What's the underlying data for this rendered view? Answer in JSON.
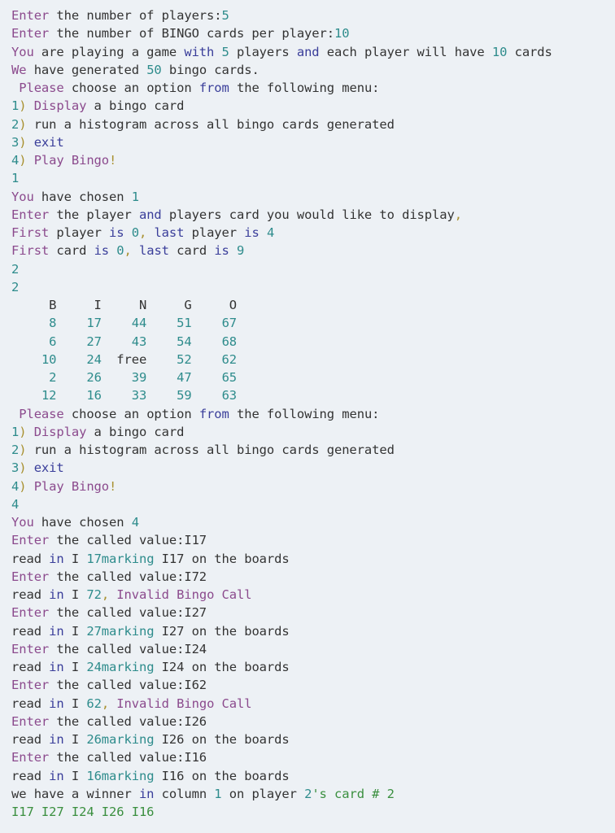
{
  "console": {
    "lines": [
      {
        "kind": "prompt",
        "tokens": [
          [
            "purple",
            "Enter"
          ],
          [
            "plain",
            " the number of players:"
          ],
          [
            "teal",
            "5"
          ]
        ]
      },
      {
        "kind": "prompt",
        "tokens": [
          [
            "purple",
            "Enter"
          ],
          [
            "plain",
            " the number of BINGO cards per player:"
          ],
          [
            "teal",
            "10"
          ]
        ]
      },
      {
        "kind": "output",
        "tokens": [
          [
            "purple",
            "You"
          ],
          [
            "plain",
            " are playing a game "
          ],
          [
            "navy",
            "with"
          ],
          [
            "plain",
            " "
          ],
          [
            "teal",
            "5"
          ],
          [
            "plain",
            " players "
          ],
          [
            "navy",
            "and"
          ],
          [
            "plain",
            " each player will have "
          ],
          [
            "teal",
            "10"
          ],
          [
            "plain",
            " cards"
          ]
        ]
      },
      {
        "kind": "output",
        "tokens": [
          [
            "purple",
            "We"
          ],
          [
            "plain",
            " have generated "
          ],
          [
            "teal",
            "50"
          ],
          [
            "plain",
            " bingo cards."
          ]
        ]
      },
      {
        "kind": "menu-title",
        "tokens": [
          [
            "plain",
            " "
          ],
          [
            "purple",
            "Please"
          ],
          [
            "plain",
            " choose an option "
          ],
          [
            "navy",
            "from"
          ],
          [
            "plain",
            " the following menu:"
          ]
        ]
      },
      {
        "kind": "menu-item",
        "tokens": [
          [
            "teal",
            "1"
          ],
          [
            "punct",
            ")"
          ],
          [
            "plain",
            " "
          ],
          [
            "purple",
            "Display"
          ],
          [
            "plain",
            " a bingo card"
          ]
        ]
      },
      {
        "kind": "menu-item",
        "tokens": [
          [
            "teal",
            "2"
          ],
          [
            "punct",
            ")"
          ],
          [
            "plain",
            " run a histogram across all bingo cards generated"
          ]
        ]
      },
      {
        "kind": "menu-item",
        "tokens": [
          [
            "teal",
            "3"
          ],
          [
            "punct",
            ")"
          ],
          [
            "plain",
            " "
          ],
          [
            "navy",
            "exit"
          ]
        ]
      },
      {
        "kind": "menu-item",
        "tokens": [
          [
            "teal",
            "4"
          ],
          [
            "punct",
            ")"
          ],
          [
            "plain",
            " "
          ],
          [
            "purple",
            "Play Bingo"
          ],
          [
            "punct",
            "!"
          ]
        ]
      },
      {
        "kind": "input",
        "tokens": [
          [
            "teal",
            "1"
          ]
        ]
      },
      {
        "kind": "output",
        "tokens": [
          [
            "purple",
            "You"
          ],
          [
            "plain",
            " have chosen "
          ],
          [
            "teal",
            "1"
          ]
        ]
      },
      {
        "kind": "prompt",
        "tokens": [
          [
            "purple",
            "Enter"
          ],
          [
            "plain",
            " the player "
          ],
          [
            "navy",
            "and"
          ],
          [
            "plain",
            " players card you would like to display"
          ],
          [
            "punct",
            ","
          ]
        ]
      },
      {
        "kind": "output",
        "tokens": [
          [
            "purple",
            "First"
          ],
          [
            "plain",
            " player "
          ],
          [
            "navy",
            "is"
          ],
          [
            "plain",
            " "
          ],
          [
            "teal",
            "0"
          ],
          [
            "punct",
            ","
          ],
          [
            "plain",
            " "
          ],
          [
            "navy",
            "last"
          ],
          [
            "plain",
            " player "
          ],
          [
            "navy",
            "is"
          ],
          [
            "plain",
            " "
          ],
          [
            "teal",
            "4"
          ]
        ]
      },
      {
        "kind": "output",
        "tokens": [
          [
            "purple",
            "First"
          ],
          [
            "plain",
            " card "
          ],
          [
            "navy",
            "is"
          ],
          [
            "plain",
            " "
          ],
          [
            "teal",
            "0"
          ],
          [
            "punct",
            ","
          ],
          [
            "plain",
            " "
          ],
          [
            "navy",
            "last"
          ],
          [
            "plain",
            " card "
          ],
          [
            "navy",
            "is"
          ],
          [
            "plain",
            " "
          ],
          [
            "teal",
            "9"
          ]
        ]
      },
      {
        "kind": "input",
        "tokens": [
          [
            "teal",
            "2"
          ]
        ]
      },
      {
        "kind": "input",
        "tokens": [
          [
            "teal",
            "2"
          ]
        ]
      },
      {
        "kind": "card-header",
        "tokens": [
          [
            "plain",
            "     B     I     N     G     O"
          ]
        ]
      },
      {
        "kind": "card-row",
        "tokens": [
          [
            "plain",
            "     "
          ],
          [
            "teal",
            "8"
          ],
          [
            "plain",
            "    "
          ],
          [
            "teal",
            "17"
          ],
          [
            "plain",
            "    "
          ],
          [
            "teal",
            "44"
          ],
          [
            "plain",
            "    "
          ],
          [
            "teal",
            "51"
          ],
          [
            "plain",
            "    "
          ],
          [
            "teal",
            "67"
          ]
        ]
      },
      {
        "kind": "card-row",
        "tokens": [
          [
            "plain",
            "     "
          ],
          [
            "teal",
            "6"
          ],
          [
            "plain",
            "    "
          ],
          [
            "teal",
            "27"
          ],
          [
            "plain",
            "    "
          ],
          [
            "teal",
            "43"
          ],
          [
            "plain",
            "    "
          ],
          [
            "teal",
            "54"
          ],
          [
            "plain",
            "    "
          ],
          [
            "teal",
            "68"
          ]
        ]
      },
      {
        "kind": "card-row",
        "tokens": [
          [
            "plain",
            "    "
          ],
          [
            "teal",
            "10"
          ],
          [
            "plain",
            "    "
          ],
          [
            "teal",
            "24"
          ],
          [
            "plain",
            "  free    "
          ],
          [
            "teal",
            "52"
          ],
          [
            "plain",
            "    "
          ],
          [
            "teal",
            "62"
          ]
        ]
      },
      {
        "kind": "card-row",
        "tokens": [
          [
            "plain",
            "     "
          ],
          [
            "teal",
            "2"
          ],
          [
            "plain",
            "    "
          ],
          [
            "teal",
            "26"
          ],
          [
            "plain",
            "    "
          ],
          [
            "teal",
            "39"
          ],
          [
            "plain",
            "    "
          ],
          [
            "teal",
            "47"
          ],
          [
            "plain",
            "    "
          ],
          [
            "teal",
            "65"
          ]
        ]
      },
      {
        "kind": "card-row",
        "tokens": [
          [
            "plain",
            "    "
          ],
          [
            "teal",
            "12"
          ],
          [
            "plain",
            "    "
          ],
          [
            "teal",
            "16"
          ],
          [
            "plain",
            "    "
          ],
          [
            "teal",
            "33"
          ],
          [
            "plain",
            "    "
          ],
          [
            "teal",
            "59"
          ],
          [
            "plain",
            "    "
          ],
          [
            "teal",
            "63"
          ]
        ]
      },
      {
        "kind": "menu-title",
        "tokens": [
          [
            "plain",
            " "
          ],
          [
            "purple",
            "Please"
          ],
          [
            "plain",
            " choose an option "
          ],
          [
            "navy",
            "from"
          ],
          [
            "plain",
            " the following menu:"
          ]
        ]
      },
      {
        "kind": "menu-item",
        "tokens": [
          [
            "teal",
            "1"
          ],
          [
            "punct",
            ")"
          ],
          [
            "plain",
            " "
          ],
          [
            "purple",
            "Display"
          ],
          [
            "plain",
            " a bingo card"
          ]
        ]
      },
      {
        "kind": "menu-item",
        "tokens": [
          [
            "teal",
            "2"
          ],
          [
            "punct",
            ")"
          ],
          [
            "plain",
            " run a histogram across all bingo cards generated"
          ]
        ]
      },
      {
        "kind": "menu-item",
        "tokens": [
          [
            "teal",
            "3"
          ],
          [
            "punct",
            ")"
          ],
          [
            "plain",
            " "
          ],
          [
            "navy",
            "exit"
          ]
        ]
      },
      {
        "kind": "menu-item",
        "tokens": [
          [
            "teal",
            "4"
          ],
          [
            "punct",
            ")"
          ],
          [
            "plain",
            " "
          ],
          [
            "purple",
            "Play Bingo"
          ],
          [
            "punct",
            "!"
          ]
        ]
      },
      {
        "kind": "input",
        "tokens": [
          [
            "teal",
            "4"
          ]
        ]
      },
      {
        "kind": "output",
        "tokens": [
          [
            "purple",
            "You"
          ],
          [
            "plain",
            " have chosen "
          ],
          [
            "teal",
            "4"
          ]
        ]
      },
      {
        "kind": "prompt",
        "tokens": [
          [
            "purple",
            "Enter"
          ],
          [
            "plain",
            " the called value:I17"
          ]
        ]
      },
      {
        "kind": "output",
        "tokens": [
          [
            "plain",
            "read "
          ],
          [
            "navy",
            "in"
          ],
          [
            "plain",
            " I "
          ],
          [
            "teal",
            "17marking"
          ],
          [
            "plain",
            " I17 on the boards"
          ]
        ]
      },
      {
        "kind": "prompt",
        "tokens": [
          [
            "purple",
            "Enter"
          ],
          [
            "plain",
            " the called value:I72"
          ]
        ]
      },
      {
        "kind": "output",
        "tokens": [
          [
            "plain",
            "read "
          ],
          [
            "navy",
            "in"
          ],
          [
            "plain",
            " I "
          ],
          [
            "teal",
            "72"
          ],
          [
            "punct",
            ","
          ],
          [
            "plain",
            " "
          ],
          [
            "purple",
            "Invalid Bingo Call"
          ]
        ]
      },
      {
        "kind": "prompt",
        "tokens": [
          [
            "purple",
            "Enter"
          ],
          [
            "plain",
            " the called value:I27"
          ]
        ]
      },
      {
        "kind": "output",
        "tokens": [
          [
            "plain",
            "read "
          ],
          [
            "navy",
            "in"
          ],
          [
            "plain",
            " I "
          ],
          [
            "teal",
            "27marking"
          ],
          [
            "plain",
            " I27 on the boards"
          ]
        ]
      },
      {
        "kind": "prompt",
        "tokens": [
          [
            "purple",
            "Enter"
          ],
          [
            "plain",
            " the called value:I24"
          ]
        ]
      },
      {
        "kind": "output",
        "tokens": [
          [
            "plain",
            "read "
          ],
          [
            "navy",
            "in"
          ],
          [
            "plain",
            " I "
          ],
          [
            "teal",
            "24marking"
          ],
          [
            "plain",
            " I24 on the boards"
          ]
        ]
      },
      {
        "kind": "prompt",
        "tokens": [
          [
            "purple",
            "Enter"
          ],
          [
            "plain",
            " the called value:I62"
          ]
        ]
      },
      {
        "kind": "output",
        "tokens": [
          [
            "plain",
            "read "
          ],
          [
            "navy",
            "in"
          ],
          [
            "plain",
            " I "
          ],
          [
            "teal",
            "62"
          ],
          [
            "punct",
            ","
          ],
          [
            "plain",
            " "
          ],
          [
            "purple",
            "Invalid Bingo Call"
          ]
        ]
      },
      {
        "kind": "prompt",
        "tokens": [
          [
            "purple",
            "Enter"
          ],
          [
            "plain",
            " the called value:I26"
          ]
        ]
      },
      {
        "kind": "output",
        "tokens": [
          [
            "plain",
            "read "
          ],
          [
            "navy",
            "in"
          ],
          [
            "plain",
            " I "
          ],
          [
            "teal",
            "26marking"
          ],
          [
            "plain",
            " I26 on the boards"
          ]
        ]
      },
      {
        "kind": "prompt",
        "tokens": [
          [
            "purple",
            "Enter"
          ],
          [
            "plain",
            " the called value:I16"
          ]
        ]
      },
      {
        "kind": "output",
        "tokens": [
          [
            "plain",
            "read "
          ],
          [
            "navy",
            "in"
          ],
          [
            "plain",
            " I "
          ],
          [
            "teal",
            "16marking"
          ],
          [
            "plain",
            " I16 on the boards"
          ]
        ]
      },
      {
        "kind": "output",
        "tokens": [
          [
            "plain",
            "we have a winner "
          ],
          [
            "navy",
            "in"
          ],
          [
            "plain",
            " column "
          ],
          [
            "teal",
            "1"
          ],
          [
            "plain",
            " on player "
          ],
          [
            "teal",
            "2"
          ],
          [
            "green",
            "'s card # 2"
          ]
        ]
      },
      {
        "kind": "output",
        "tokens": [
          [
            "green",
            "I17 I27 I24 I26 I16"
          ]
        ]
      }
    ]
  },
  "colors": {
    "background": "#edf1f5",
    "plain": "#333333",
    "purple": "#8b4a8d",
    "teal": "#2e8c8c",
    "navy": "#3a3e9a",
    "punct": "#a8902f",
    "green": "#3a8f3f"
  }
}
